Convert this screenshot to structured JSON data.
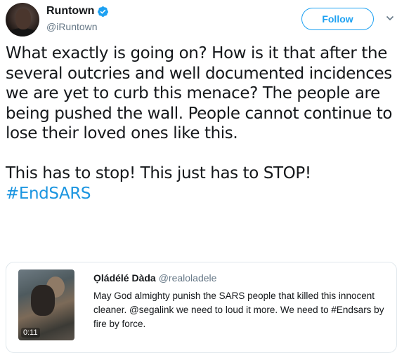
{
  "author": {
    "display_name": "Runtown",
    "handle": "@iRuntown",
    "verified": true
  },
  "follow_button": {
    "label": "Follow"
  },
  "tweet": {
    "paragraph_1": "What exactly is going on? How is it that after the several outcries and well documented incidences we are yet to curb this menace? The people are being pushed the wall. People cannot continue to lose their loved ones like this.",
    "paragraph_2": "This has to stop! This just has to STOP!",
    "hashtag": "#EndSARS"
  },
  "quoted_tweet": {
    "display_name": "Ọládélé Dàda",
    "handle": "@realoladele",
    "text": "May God almighty punish the SARS people that killed this innocent cleaner. @segalink we need to loud it more. We need to #Endsars by fire by force.",
    "media_duration": "0:11"
  },
  "colors": {
    "accent": "#1da1f2",
    "link": "#1b95e0",
    "text": "#14171a",
    "muted": "#657786",
    "border": "#e1e8ed"
  },
  "icons": [
    "verified-badge-icon",
    "chevron-down-icon"
  ]
}
